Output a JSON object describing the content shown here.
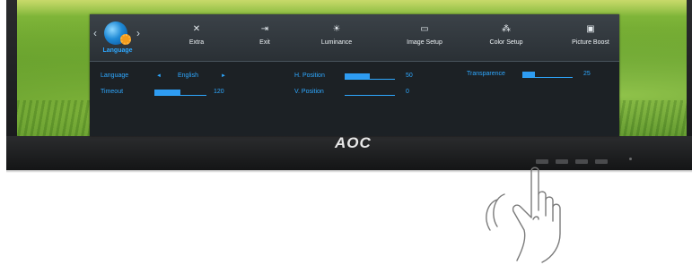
{
  "brand": {
    "logo_text": "AOC"
  },
  "osd": {
    "active_section_label": "Language",
    "nav_left": "‹",
    "nav_right": "›",
    "tabs": [
      {
        "label": "Extra",
        "icon": "extra-icon"
      },
      {
        "label": "Exit",
        "icon": "exit-icon"
      },
      {
        "label": "Luminance",
        "icon": "luminance-icon"
      },
      {
        "label": "Image Setup",
        "icon": "image-setup-icon"
      },
      {
        "label": "Color Setup",
        "icon": "color-setup-icon"
      },
      {
        "label": "Picture Boost",
        "icon": "picture-boost-icon"
      }
    ],
    "settings": {
      "language": {
        "label": "Language",
        "value": "English",
        "left_arrow": "◄",
        "right_arrow": "►"
      },
      "timeout": {
        "label": "Timeout",
        "value": "120",
        "level": 0.5
      },
      "h_position": {
        "label": "H. Position",
        "value": "50",
        "level": 0.5
      },
      "v_position": {
        "label": "V. Position",
        "value": "0",
        "level": 0.0
      },
      "transparence": {
        "label": "Transparence",
        "value": "25",
        "level": 0.25
      }
    }
  },
  "colors": {
    "accent": "#2ea8ff",
    "osd_bg": "#21262a"
  }
}
